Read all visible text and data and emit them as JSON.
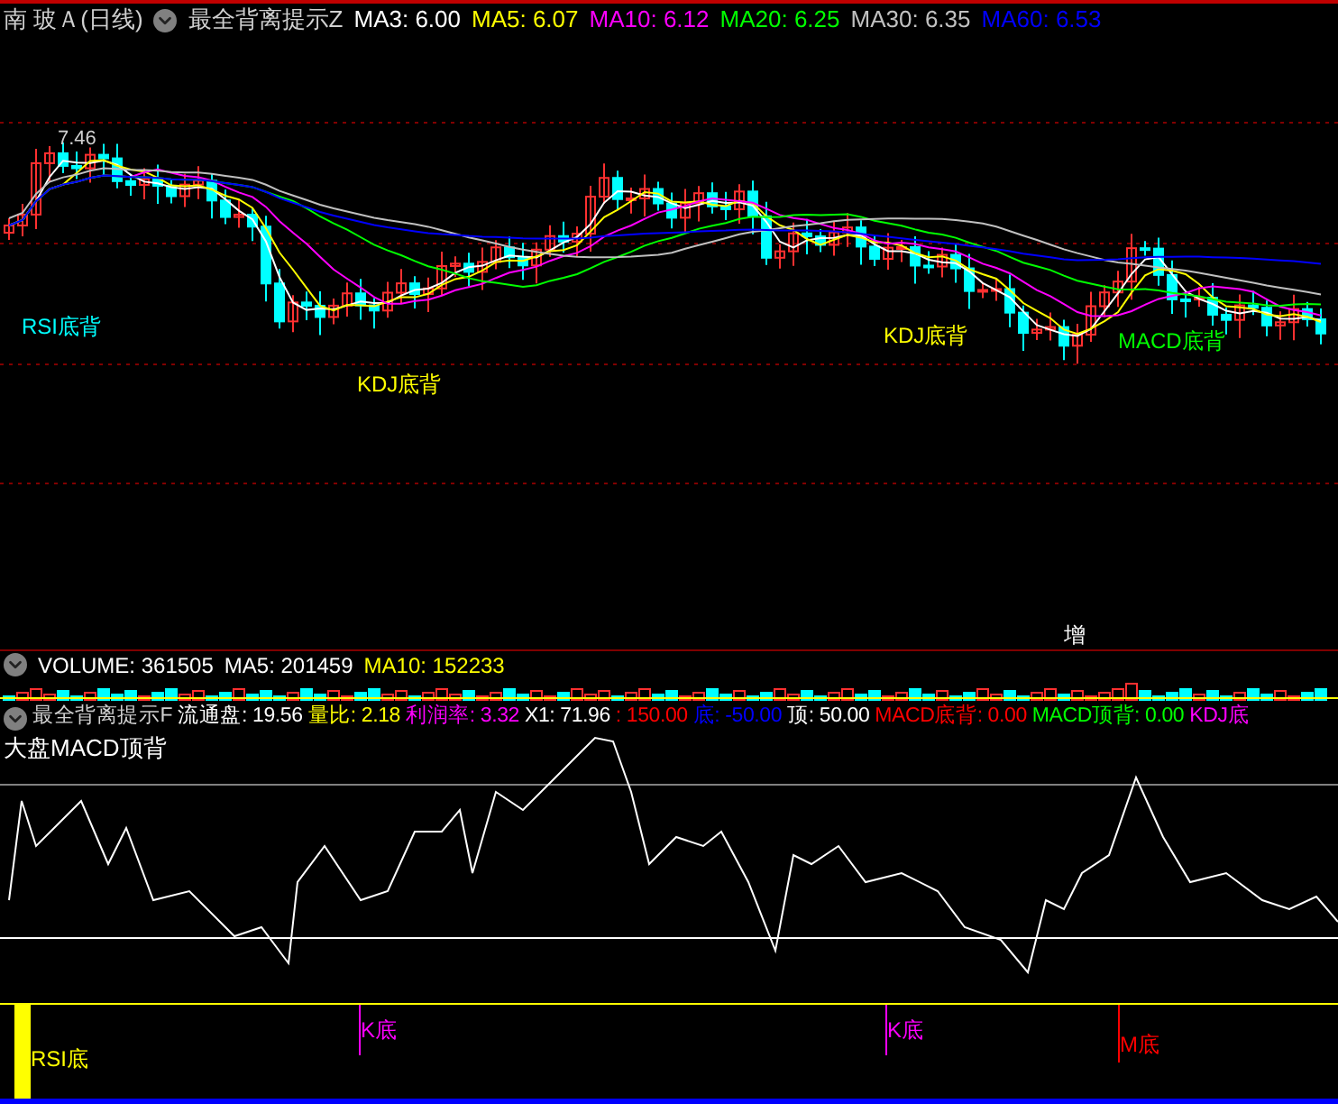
{
  "header": {
    "title": "南 玻Ａ(日线)",
    "indicator": "最全背离提示Z",
    "values": [
      {
        "label": "MA3: 6.00",
        "color": "#ffffff"
      },
      {
        "label": "MA5: 6.07",
        "color": "#ffff00"
      },
      {
        "label": "MA10: 6.12",
        "color": "#ff00ff"
      },
      {
        "label": "MA20: 6.25",
        "color": "#00ff00"
      },
      {
        "label": "MA30: 6.35",
        "color": "#c0c0c0"
      },
      {
        "label": "MA60: 6.53",
        "color": "#0000ff"
      }
    ]
  },
  "main_chart": {
    "high_label": "7.46",
    "marker": "增",
    "signals": [
      {
        "label": "RSI底背",
        "color": "#00ffff"
      },
      {
        "label": "KDJ底背",
        "color": "#ffff00"
      },
      {
        "label": "KDJ底背",
        "color": "#ffff00"
      },
      {
        "label": "MACD底背",
        "color": "#00ff00"
      }
    ]
  },
  "volume": {
    "values": [
      {
        "label": "VOLUME: 361505",
        "color": "#ffffff"
      },
      {
        "label": "MA5: 201459",
        "color": "#ffffff"
      },
      {
        "label": "MA10: 152233",
        "color": "#ffff00"
      }
    ]
  },
  "indicator": {
    "name": "最全背离提示F",
    "values": [
      {
        "label": "流通盘: 19.56",
        "color": "#ffffff"
      },
      {
        "label": "量比: 2.18",
        "color": "#ffff00"
      },
      {
        "label": "利润率: 3.32",
        "color": "#ff00ff"
      },
      {
        "label": "X1: 71.96",
        "color": "#ffffff"
      },
      {
        "label": ": 150.00",
        "color": "#ff0000"
      },
      {
        "label": "底: -50.00",
        "color": "#0000ff"
      },
      {
        "label": "顶: 50.00",
        "color": "#ffffff"
      },
      {
        "label": "MACD底背: 0.00",
        "color": "#ff0000"
      },
      {
        "label": "MACD顶背: 0.00",
        "color": "#00ff00"
      },
      {
        "label": "KDJ底",
        "color": "#ff00ff"
      }
    ]
  },
  "macd_panel": {
    "title": "大盘MACD顶背"
  },
  "signal_panel": {
    "signals": [
      {
        "label": "RSI底",
        "color": "#ffff00"
      },
      {
        "label": "K底",
        "color": "#ff00ff"
      },
      {
        "label": "K底",
        "color": "#ff00ff"
      },
      {
        "label": "M底",
        "color": "#ff0000"
      }
    ]
  }
}
